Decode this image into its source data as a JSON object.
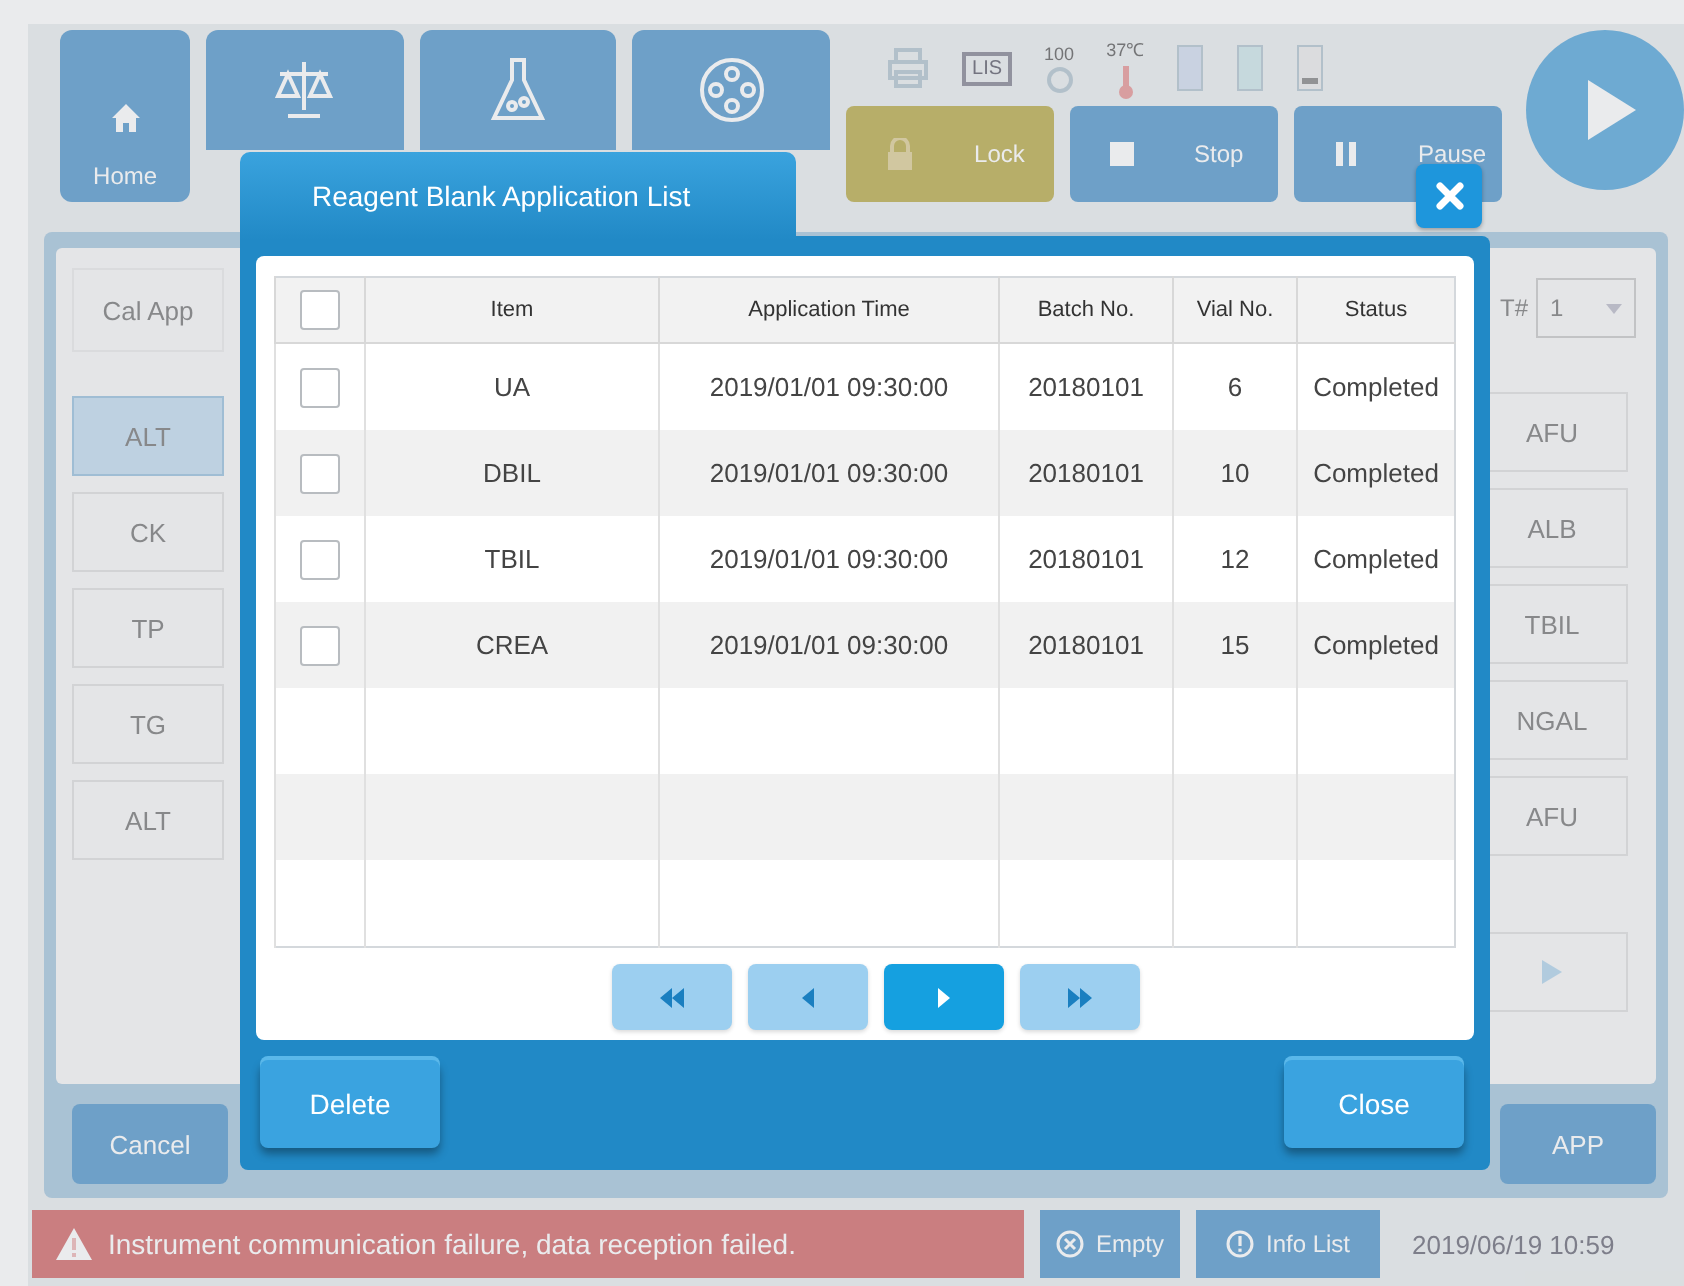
{
  "toolbar": {
    "home": "Home",
    "lock": "Lock",
    "stop": "Stop",
    "pause": "Pause"
  },
  "status_icons": {
    "lis": "LIS",
    "counter": "100",
    "temperature": "37℃"
  },
  "panel": {
    "header": "Cal App",
    "tray_label": "T#",
    "tray_value": "1",
    "left_items": [
      {
        "label": "ALT",
        "selected": true
      },
      {
        "label": "CK",
        "selected": false
      },
      {
        "label": "TP",
        "selected": false
      },
      {
        "label": "TG",
        "selected": false
      },
      {
        "label": "ALT",
        "selected": false
      }
    ],
    "right_items": [
      {
        "label": "AFU",
        "selected": false
      },
      {
        "label": "ALB",
        "selected": false
      },
      {
        "label": "TBIL",
        "selected": false
      },
      {
        "label": "NGAL",
        "selected": false
      },
      {
        "label": "AFU",
        "selected": false
      }
    ]
  },
  "actions": {
    "cancel": "Cancel",
    "app": "APP"
  },
  "status_bar": {
    "message": "Instrument communication failure, data reception failed.",
    "empty": "Empty",
    "info": "Info List",
    "datetime": "2019/06/19 10:59"
  },
  "dialog": {
    "title": "Reagent Blank Application List",
    "select_all_checked": false,
    "columns": [
      "Item",
      "Application Time",
      "Batch No.",
      "Vial No.",
      "Status"
    ],
    "rows": [
      {
        "checked": false,
        "cells": [
          "UA",
          "2019/01/01 09:30:00",
          "20180101",
          "6",
          "Completed"
        ]
      },
      {
        "checked": false,
        "cells": [
          "DBIL",
          "2019/01/01 09:30:00",
          "20180101",
          "10",
          "Completed"
        ]
      },
      {
        "checked": false,
        "cells": [
          "TBIL",
          "2019/01/01 09:30:00",
          "20180101",
          "12",
          "Completed"
        ]
      },
      {
        "checked": false,
        "cells": [
          "CREA",
          "2019/01/01 09:30:00",
          "20180101",
          "15",
          "Completed"
        ]
      }
    ],
    "pager": [
      {
        "kind": "first",
        "selected": false
      },
      {
        "kind": "prev",
        "selected": false
      },
      {
        "kind": "next",
        "selected": true
      },
      {
        "kind": "last",
        "selected": false
      }
    ],
    "buttons": {
      "delete": "Delete",
      "close": "Close"
    }
  }
}
